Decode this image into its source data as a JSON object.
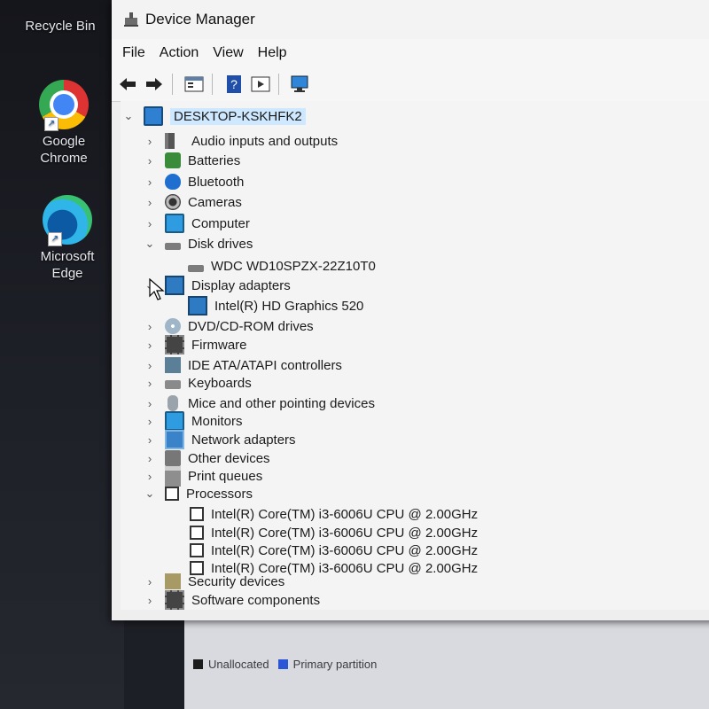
{
  "desktop": {
    "icons": [
      {
        "label": "Recycle Bin",
        "icon": "recycle-bin-icon"
      },
      {
        "label": "Google Chrome",
        "icon": "chrome-icon"
      },
      {
        "label": "Microsoft Edge",
        "icon": "edge-icon"
      }
    ]
  },
  "window": {
    "title": "Device Manager",
    "menu": [
      "File",
      "Action",
      "View",
      "Help"
    ],
    "toolbar": [
      "back-icon",
      "forward-icon",
      "properties-icon",
      "help-icon",
      "run-icon",
      "scan-hardware-icon"
    ]
  },
  "tree": {
    "root": "DESKTOP-KSKHFK2",
    "nodes": [
      {
        "label": "Audio inputs and outputs",
        "expanded": false,
        "icon": "speaker-icon"
      },
      {
        "label": "Batteries",
        "expanded": false,
        "icon": "battery-icon"
      },
      {
        "label": "Bluetooth",
        "expanded": false,
        "icon": "bluetooth-icon"
      },
      {
        "label": "Cameras",
        "expanded": false,
        "icon": "camera-icon"
      },
      {
        "label": "Computer",
        "expanded": false,
        "icon": "computer-icon"
      },
      {
        "label": "Disk drives",
        "expanded": true,
        "icon": "disk-icon"
      },
      {
        "label": "WDC WD10SPZX-22Z10T0",
        "child": true,
        "icon": "disk-icon"
      },
      {
        "label": "Display adapters",
        "expanded": true,
        "icon": "display-adapter-icon"
      },
      {
        "label": "Intel(R) HD Graphics 520",
        "child": true,
        "icon": "display-adapter-icon"
      },
      {
        "label": "DVD/CD-ROM drives",
        "expanded": false,
        "icon": "dvd-icon"
      },
      {
        "label": "Firmware",
        "expanded": false,
        "icon": "firmware-icon"
      },
      {
        "label": "IDE ATA/ATAPI controllers",
        "expanded": false,
        "icon": "ide-icon"
      },
      {
        "label": "Keyboards",
        "expanded": false,
        "icon": "keyboard-icon"
      },
      {
        "label": "Mice and other pointing devices",
        "expanded": false,
        "icon": "mouse-icon"
      },
      {
        "label": "Monitors",
        "expanded": false,
        "icon": "monitor-icon"
      },
      {
        "label": "Network adapters",
        "expanded": false,
        "icon": "network-icon"
      },
      {
        "label": "Other devices",
        "expanded": false,
        "icon": "other-devices-icon"
      },
      {
        "label": "Print queues",
        "expanded": false,
        "icon": "printer-icon"
      },
      {
        "label": "Processors",
        "expanded": true,
        "icon": "processor-icon"
      },
      {
        "label": "Intel(R) Core(TM) i3-6006U CPU @ 2.00GHz",
        "child": true,
        "icon": "processor-icon"
      },
      {
        "label": "Intel(R) Core(TM) i3-6006U CPU @ 2.00GHz",
        "child": true,
        "icon": "processor-icon"
      },
      {
        "label": "Intel(R) Core(TM) i3-6006U CPU @ 2.00GHz",
        "child": true,
        "icon": "processor-icon"
      },
      {
        "label": "Intel(R) Core(TM) i3-6006U CPU @ 2.00GHz",
        "child": true,
        "icon": "processor-icon"
      },
      {
        "label": "Security devices",
        "expanded": false,
        "icon": "security-icon"
      },
      {
        "label": "Software components",
        "expanded": false,
        "icon": "software-icon"
      }
    ]
  },
  "disk_legend": {
    "unallocated": "Unallocated",
    "primary": "Primary partition",
    "colors": {
      "unallocated": "#1c1c1c",
      "primary": "#2a55d6"
    }
  },
  "colors": {
    "selection": "#cde8ff"
  }
}
